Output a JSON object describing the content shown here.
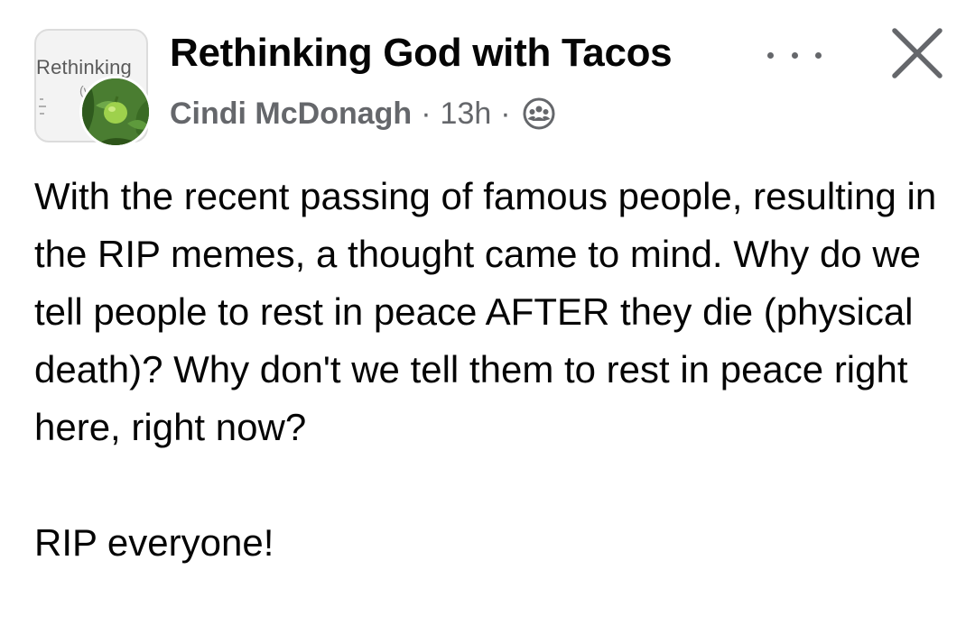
{
  "group": {
    "name": "Rethinking God with Tacos",
    "avatar_text": "Rethinking",
    "avatar_sub": "(v"
  },
  "post": {
    "author": "Cindi McDonagh",
    "separator": "·",
    "time": "13h",
    "privacy_icon": "group-audience-icon",
    "paragraphs": [
      "With the recent passing of famous people, resulting in the RIP memes, a thought came to mind.  Why do we tell people to rest in peace AFTER they die (physical death)? Why don't we tell them to rest in peace right here, right now?",
      "RIP everyone!"
    ]
  },
  "actions": {
    "more_icon": "more-options-icon",
    "close_icon": "close-icon"
  },
  "colors": {
    "primary_text": "#050505",
    "secondary_text": "#65676b",
    "background": "#ffffff"
  }
}
